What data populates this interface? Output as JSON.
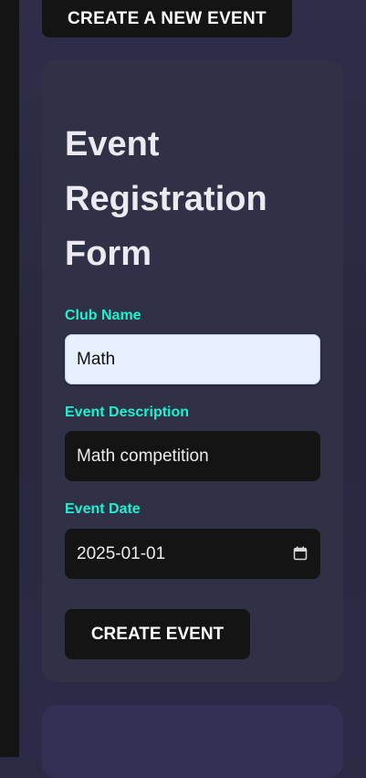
{
  "top_button": {
    "label": "CREATE A NEW EVENT"
  },
  "form": {
    "title_line1": "Event",
    "title_line2": "Registration",
    "title_line3": "Form",
    "club_name": {
      "label": "Club Name",
      "value": "Math"
    },
    "event_description": {
      "label": "Event Description",
      "value": "Math competition"
    },
    "event_date": {
      "label": "Event Date",
      "value": "2025-01-01"
    },
    "submit_label": "CREATE EVENT"
  },
  "colors": {
    "accent": "#1ff0cf",
    "card": "#303047",
    "button": "#141414"
  },
  "icons": {
    "date_picker": "calendar-icon"
  }
}
